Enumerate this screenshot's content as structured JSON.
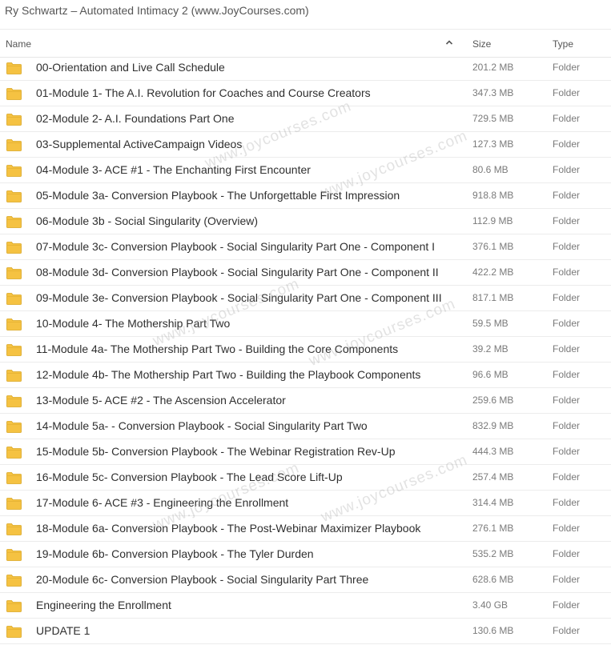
{
  "window_title": "Ry Schwartz – Automated Intimacy 2 (www.JoyCourses.com)",
  "columns": {
    "name": "Name",
    "size": "Size",
    "type": "Type"
  },
  "sort_icon": "chevron-up-icon",
  "folder_icon": "folder-icon",
  "folder_color": "#f5c242",
  "watermark_text": "www.joycourses.com",
  "rows": [
    {
      "name": "00-Orientation and Live Call Schedule",
      "size": "201.2 MB",
      "type": "Folder"
    },
    {
      "name": "01-Module 1- The A.I. Revolution for Coaches and Course Creators",
      "size": "347.3 MB",
      "type": "Folder"
    },
    {
      "name": "02-Module 2- A.I. Foundations Part One",
      "size": "729.5 MB",
      "type": "Folder"
    },
    {
      "name": "03-Supplemental ActiveCampaign Videos",
      "size": "127.3 MB",
      "type": "Folder"
    },
    {
      "name": "04-Module 3- ACE #1 - The Enchanting First Encounter",
      "size": "80.6 MB",
      "type": "Folder"
    },
    {
      "name": "05-Module 3a- Conversion Playbook - The Unforgettable First Impression",
      "size": "918.8 MB",
      "type": "Folder"
    },
    {
      "name": "06-Module 3b - Social Singularity (Overview)",
      "size": "112.9 MB",
      "type": "Folder"
    },
    {
      "name": "07-Module 3c- Conversion Playbook - Social Singularity Part One - Component I",
      "size": "376.1 MB",
      "type": "Folder"
    },
    {
      "name": "08-Module 3d- Conversion Playbook - Social Singularity Part One - Component II",
      "size": "422.2 MB",
      "type": "Folder"
    },
    {
      "name": "09-Module 3e- Conversion Playbook - Social Singularity Part One - Component III",
      "size": "817.1 MB",
      "type": "Folder"
    },
    {
      "name": "10-Module 4- The Mothership Part Two",
      "size": "59.5 MB",
      "type": "Folder"
    },
    {
      "name": "11-Module 4a- The Mothership Part Two - Building the Core Components",
      "size": "39.2 MB",
      "type": "Folder"
    },
    {
      "name": "12-Module 4b- The Mothership Part Two - Building the Playbook Components",
      "size": "96.6 MB",
      "type": "Folder"
    },
    {
      "name": "13-Module 5- ACE #2 - The Ascension Accelerator",
      "size": "259.6 MB",
      "type": "Folder"
    },
    {
      "name": "14-Module 5a- - Conversion Playbook - Social Singularity Part Two",
      "size": "832.9 MB",
      "type": "Folder"
    },
    {
      "name": "15-Module 5b- Conversion Playbook - The Webinar Registration Rev-Up",
      "size": "444.3 MB",
      "type": "Folder"
    },
    {
      "name": "16-Module 5c- Conversion Playbook - The Lead Score Lift-Up",
      "size": "257.4 MB",
      "type": "Folder"
    },
    {
      "name": "17-Module 6- ACE #3 - Engineering the Enrollment",
      "size": "314.4 MB",
      "type": "Folder"
    },
    {
      "name": "18-Module 6a- Conversion Playbook - The Post-Webinar Maximizer Playbook",
      "size": "276.1 MB",
      "type": "Folder"
    },
    {
      "name": "19-Module 6b- Conversion Playbook - The Tyler Durden",
      "size": "535.2 MB",
      "type": "Folder"
    },
    {
      "name": "20-Module 6c- Conversion Playbook - Social Singularity Part Three",
      "size": "628.6 MB",
      "type": "Folder"
    },
    {
      "name": "Engineering the Enrollment",
      "size": "3.40 GB",
      "type": "Folder"
    },
    {
      "name": "UPDATE 1",
      "size": "130.6 MB",
      "type": "Folder"
    }
  ]
}
